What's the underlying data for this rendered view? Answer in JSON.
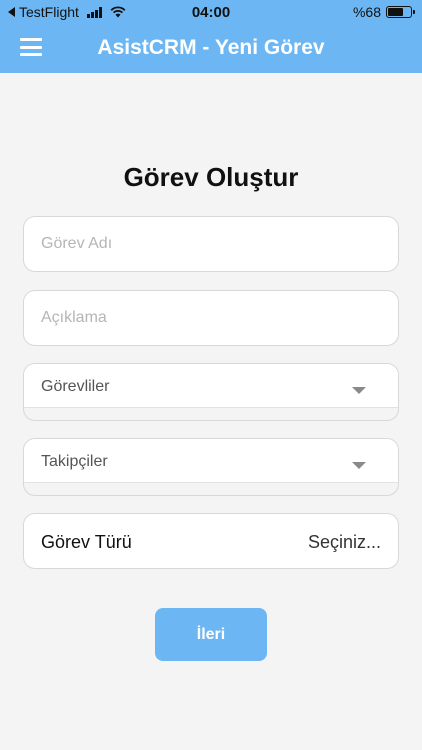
{
  "status_bar": {
    "app": "TestFlight",
    "time": "04:00",
    "battery": "%68",
    "battery_level": 0.68
  },
  "header": {
    "title": "AsistCRM - Yeni Görev"
  },
  "form": {
    "title": "Görev Oluştur",
    "task_name_placeholder": "Görev Adı",
    "description_placeholder": "Açıklama",
    "assignees_label": "Görevliler",
    "followers_label": "Takipçiler",
    "task_type_label": "Görev Türü",
    "task_type_value": "Seçiniz...",
    "next_label": "İleri"
  },
  "icons": {
    "menu": "hamburger-icon",
    "dropdown": "caret-down-icon",
    "back": "back-arrow-icon",
    "signal": "signal-icon",
    "wifi": "wifi-icon",
    "battery": "battery-icon"
  },
  "colors": {
    "accent": "#6cb7f3",
    "background": "#f4f4f4"
  }
}
